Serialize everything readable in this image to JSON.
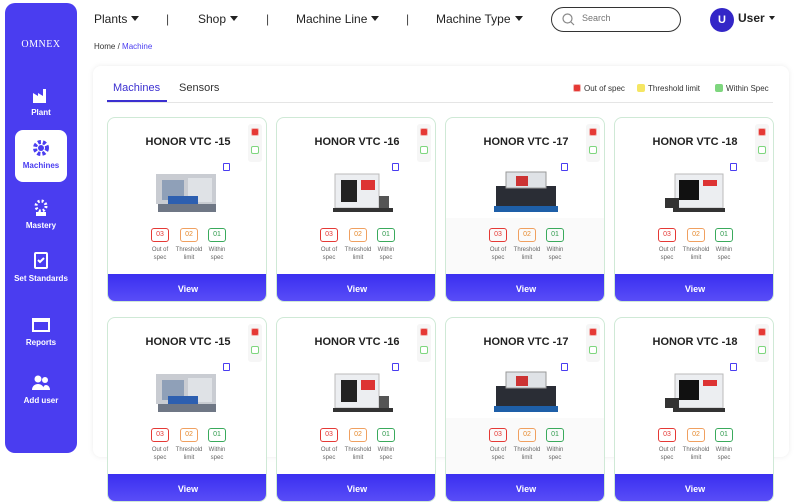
{
  "brand": "OMNEX",
  "sidebar": {
    "items": [
      {
        "label": "Plant",
        "icon": "factory-icon"
      },
      {
        "label": "Machines",
        "icon": "gear-icon",
        "active": true
      },
      {
        "label": "Mastery",
        "icon": "settings-icon"
      },
      {
        "label": "Set Standards",
        "icon": "document-check-icon"
      },
      {
        "label": "Reports",
        "icon": "folder-icon"
      },
      {
        "label": "Add user",
        "icon": "users-icon"
      }
    ]
  },
  "topbar": {
    "filters": [
      "Plants",
      "Shop",
      "Machine Line",
      "Machine Type"
    ],
    "search_placeholder": "Search",
    "user_initial": "U",
    "user_name": "User"
  },
  "breadcrumb": {
    "home": "Home",
    "separator": "/",
    "current": "Machine"
  },
  "tabs": [
    "Machines",
    "Sensors"
  ],
  "legend": [
    {
      "label": "Out of spec",
      "color": "#e53935"
    },
    {
      "label": "Threshold limit",
      "color": "#f5e663"
    },
    {
      "label": "Within Spec",
      "color": "#7ed67e"
    }
  ],
  "cards": [
    {
      "title": "HONOR VTC -15",
      "out": "03",
      "threshold": "02",
      "within": "01"
    },
    {
      "title": "HONOR VTC -16",
      "out": "03",
      "threshold": "02",
      "within": "01"
    },
    {
      "title": "HONOR VTC -17",
      "out": "03",
      "threshold": "02",
      "within": "01"
    },
    {
      "title": "HONOR VTC -18",
      "out": "03",
      "threshold": "02",
      "within": "01"
    },
    {
      "title": "HONOR VTC -15",
      "out": "03",
      "threshold": "02",
      "within": "01"
    },
    {
      "title": "HONOR VTC -16",
      "out": "03",
      "threshold": "02",
      "within": "01"
    },
    {
      "title": "HONOR VTC -17",
      "out": "03",
      "threshold": "02",
      "within": "01"
    },
    {
      "title": "HONOR VTC -18",
      "out": "03",
      "threshold": "02",
      "within": "01"
    }
  ],
  "stat_labels": {
    "out": "Out of spec",
    "threshold": "Threshold limit",
    "within": "Within spec"
  },
  "view_label": "View"
}
